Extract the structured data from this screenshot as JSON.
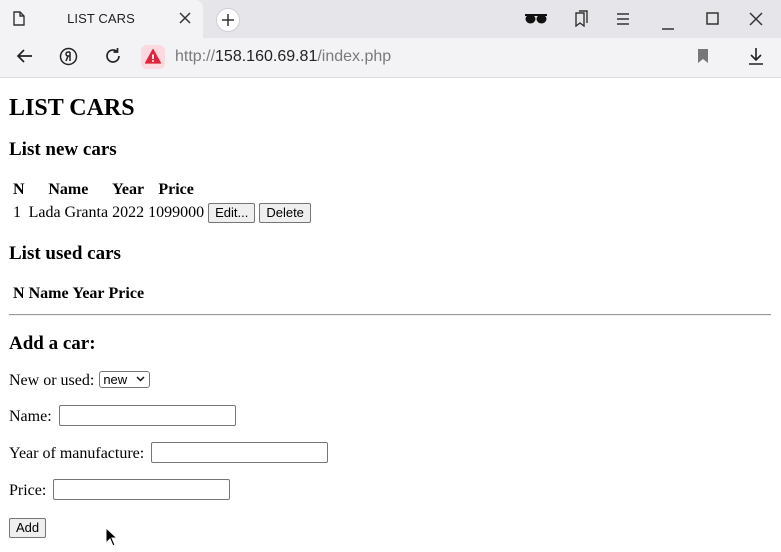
{
  "browser": {
    "tab_title": "LIST CARS",
    "url": {
      "protocol": "http://",
      "host": "158.160.69.81",
      "path": "/index.php"
    },
    "icons": [
      "page-icon",
      "tab-close-icon",
      "new-tab-icon",
      "reader-glasses-icon",
      "collections-icon",
      "menu-icon",
      "minimize-icon",
      "maximize-icon",
      "close-window-icon",
      "back-icon",
      "yandex-icon",
      "reload-icon",
      "security-warning-icon",
      "bookmark-icon",
      "download-icon"
    ],
    "colors": {
      "security_warning": "#e0243b"
    }
  },
  "page": {
    "title": "LIST CARS",
    "new_cars": {
      "heading": "List new cars",
      "columns": [
        "N",
        "Name",
        "Year",
        "Price"
      ],
      "rows": [
        {
          "n": "1",
          "name": "Lada Granta",
          "year": "2022",
          "price": "1099000",
          "edit_label": "Edit...",
          "delete_label": "Delete"
        }
      ]
    },
    "used_cars": {
      "heading": "List used cars",
      "columns": [
        "N",
        "Name",
        "Year",
        "Price"
      ]
    },
    "form": {
      "heading": "Add a car:",
      "type_label": "New or used:",
      "type_value": "new",
      "name_label": "Name:",
      "name_value": "",
      "year_label": "Year of manufacture:",
      "year_value": "",
      "price_label": "Price:",
      "price_value": "",
      "submit_label": "Add"
    }
  }
}
